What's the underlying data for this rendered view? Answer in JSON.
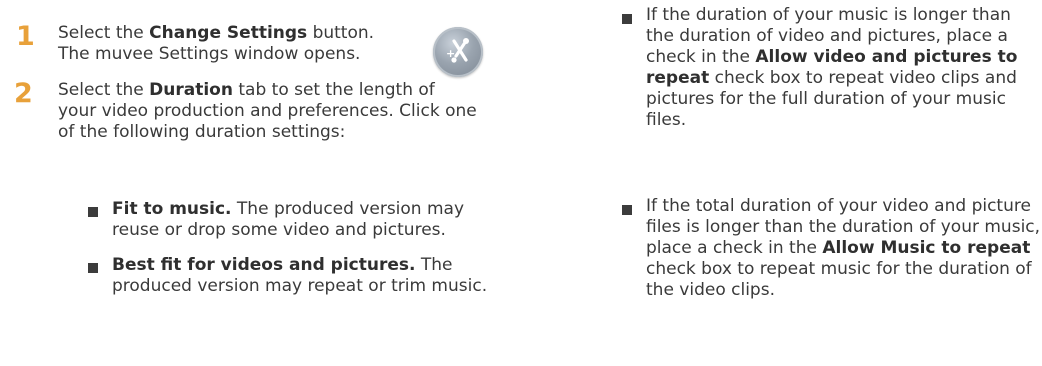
{
  "left": {
    "step1": {
      "number": "1",
      "prefix": "Select the ",
      "bold": "Change Settings",
      "suffix": " button.",
      "line2": "The muvee Settings window opens."
    },
    "step2": {
      "number": "2",
      "prefix": "Select the ",
      "bold": "Duration",
      "rest": " tab to set the length of your video production and preferences. Click one of the following duration settings:"
    },
    "bullets": [
      {
        "bold": "Fit to music.",
        "rest": " The produced version may reuse or drop some video and pictures."
      },
      {
        "bold": "Best fit for videos and pictures.",
        "rest": " The produced version may repeat or trim music."
      }
    ],
    "icon": "change-settings-icon"
  },
  "right": {
    "bullets": [
      {
        "pre": "If the duration of your music is longer than the duration of video and pictures, place a check in the ",
        "bold": "Allow video and pictures to repeat",
        "post": " check box to repeat video clips and pictures for the full duration of your music files."
      },
      {
        "pre": "If the total duration of your video and picture files is longer than the duration of your music, place a check in the ",
        "bold": "Allow Music to repeat",
        "post": " check box to repeat music for the duration of the video clips."
      }
    ]
  },
  "colors": {
    "step_number": "#e8a13a",
    "text": "#3a3a3a",
    "bullet": "#3c3c3c"
  }
}
